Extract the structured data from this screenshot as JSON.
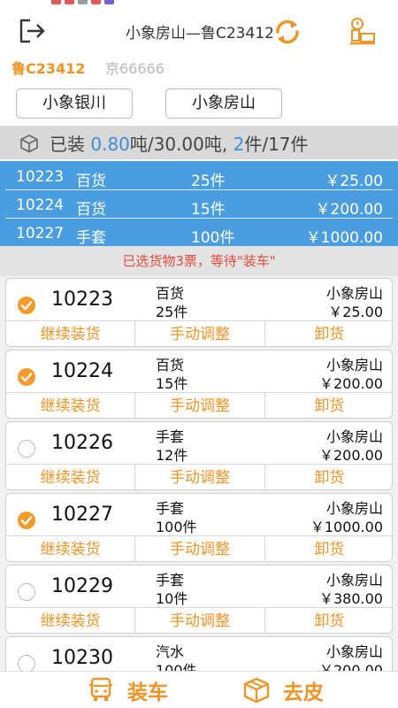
{
  "colors": {
    "accent": "#f09426",
    "selected_bg": "#4a9ee0",
    "summary_bg": "#d9d9d9",
    "notice_text": "#e34a3a",
    "check_on": "#f39b2c"
  },
  "header": {
    "title": "小象房山—鲁C23412",
    "logout_icon": "logout-icon",
    "refresh_icon": "refresh-icon",
    "scan_icon": "scale-icon"
  },
  "plates": {
    "active": "鲁C23412",
    "inactive": "京66666"
  },
  "locations": [
    "小象银川",
    "小象房山"
  ],
  "summary": {
    "prefix": "已装 ",
    "weight_loaded": "0.80",
    "weight_sep": "吨/30.00吨, ",
    "pieces_loaded": "2",
    "pieces_total": "件/17件"
  },
  "selected_rows": [
    {
      "code": "10223",
      "category": "百货",
      "qty": "25件",
      "price": "￥25.00"
    },
    {
      "code": "10224",
      "category": "百货",
      "qty": "15件",
      "price": "￥200.00"
    },
    {
      "code": "10227",
      "category": "手套",
      "qty": "100件",
      "price": "￥1000.00"
    }
  ],
  "notice": "已选货物3票，等待\"装车\"",
  "cards": [
    {
      "checked": true,
      "code": "10223",
      "category": "百货",
      "qty": "25件",
      "dest": "小象房山",
      "price": "￥25.00"
    },
    {
      "checked": true,
      "code": "10224",
      "category": "百货",
      "qty": "15件",
      "dest": "小象房山",
      "price": "￥200.00"
    },
    {
      "checked": false,
      "code": "10226",
      "category": "手套",
      "qty": "12件",
      "dest": "小象房山",
      "price": "￥200.00"
    },
    {
      "checked": true,
      "code": "10227",
      "category": "手套",
      "qty": "100件",
      "dest": "小象房山",
      "price": "￥1000.00"
    },
    {
      "checked": false,
      "code": "10229",
      "category": "手套",
      "qty": "10件",
      "dest": "小象房山",
      "price": "￥380.00"
    },
    {
      "checked": false,
      "code": "10230",
      "category": "汽水",
      "qty": "100件",
      "dest": "小象房山",
      "price": "￥200.00"
    }
  ],
  "card_actions": [
    "继续装货",
    "手动调整",
    "卸货"
  ],
  "bottom": {
    "load_label": "装车",
    "tare_label": "去皮"
  }
}
